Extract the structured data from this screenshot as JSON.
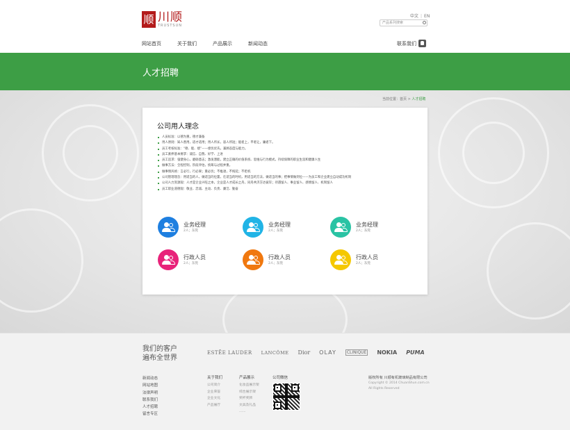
{
  "header": {
    "logo_mark": "顺",
    "logo_cn": "川顺",
    "logo_en": "TRUSTSUN",
    "lang": [
      "中文",
      "EN"
    ],
    "search_placeholder": "产品系列搜索",
    "nav": [
      "网站首页",
      "关于我们",
      "产品展示",
      "新闻动态"
    ],
    "contact_label": "联系我们"
  },
  "banner": {
    "title": "人才招聘"
  },
  "breadcrumb": {
    "prefix": "当前位置：",
    "home": "首页",
    "sep": " > ",
    "current": "人才招聘"
  },
  "content": {
    "heading": "公司用人理念",
    "policies": [
      "人员标准：以德为重，德才兼备",
      "用人原则：知人善用，适才适用；用人所长，容人所短；能者上，平者让，庸者下。",
      "员工考核标准：“德、能、绩”——绩优优先，兼顾态度与能力。",
      "员工素养基本要求：诚信、自我、好学、上进",
      "员工追求：强健身心，磨砺意志；激发潜能，建立正确的价值系统、思维与行为模式，持续保障的职业生涯和健康人生",
      "做事方法：全程控制，阶段评估，统筹与过程并重。",
      "做事情风格：言必行，行必果；重必优；不推诿，不拖延；不拒机",
      "公司管理理念：用适当的人，做适当的位置，在适当的时机，用适当的方法，做适当的事；把事情做到位——为员工和企业建立自动成功机制",
      "公司人力资源观：人才是企业兴旺之本，企业是人才成长之舟，同舟共济方达彼岸；待遇留人、事业留人、感情留人、机制留人",
      "员工职业道德观：敬业、忠诚、主动、负责、廉洁、勤奋"
    ],
    "jobs": [
      {
        "title": "业务经理",
        "sub": "2人；东莞",
        "color": "#1e7fe0"
      },
      {
        "title": "业务经理",
        "sub": "2人；东莞",
        "color": "#21b4e6"
      },
      {
        "title": "业务经理",
        "sub": "2人；东莞",
        "color": "#2ac3a4"
      },
      {
        "title": "行政人员",
        "sub": "2人；东莞",
        "color": "#e8237a"
      },
      {
        "title": "行政人员",
        "sub": "2人；东莞",
        "color": "#f0780f"
      },
      {
        "title": "行政人员",
        "sub": "2人；东莞",
        "color": "#f5c800"
      }
    ]
  },
  "footer": {
    "slogan_line1": "我们的客户",
    "slogan_line2": "遍布全世界",
    "brands": [
      "ESTĒE LAUDER",
      "LANCÔME",
      "Dior",
      "OLAY",
      "CLINIQUE",
      "NOKIA",
      "PUMA"
    ],
    "links": [
      "新闻动态",
      "网站地图",
      "法律声明",
      "联系我们",
      "人才招聘",
      "留言专区"
    ],
    "about": {
      "head": "关于我们",
      "items": [
        "公司简介",
        "企业荣誉",
        "企业文化",
        "产品展厅"
      ]
    },
    "products": {
      "head": "产品展示",
      "items": [
        "化妆品展示架",
        "综合展示架",
        "奖杯奖牌",
        "文具及礼品",
        "……"
      ]
    },
    "wechat_head": "公司微信",
    "copyright": [
      "版权所有  川顺有机玻璃制品有限公司",
      "Copyright © 2014 ChuanShun.com.cn",
      "All Rights Reserved"
    ]
  }
}
